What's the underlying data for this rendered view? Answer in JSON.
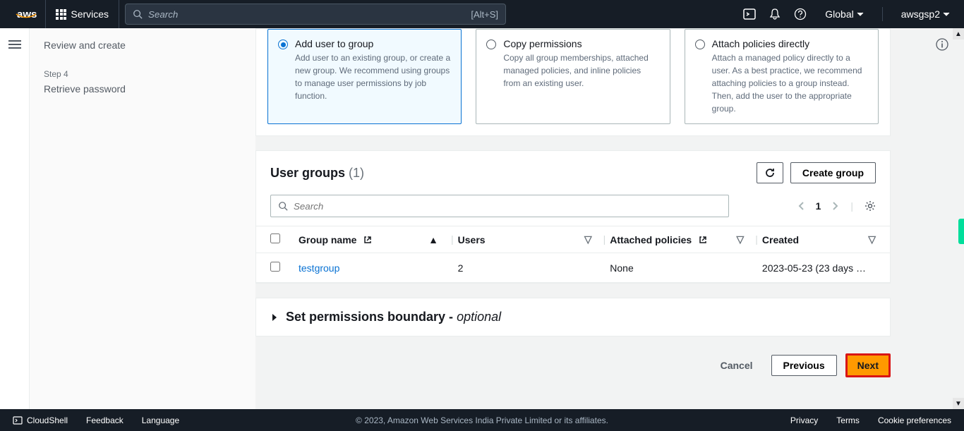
{
  "header": {
    "logo": "aws",
    "services": "Services",
    "search_placeholder": "Search",
    "shortcut": "[Alt+S]",
    "region": "Global",
    "account": "awsgsp2"
  },
  "sidebar": {
    "items": [
      {
        "label": "Review and create"
      },
      {
        "step": "Step 4",
        "label": "Retrieve password"
      }
    ]
  },
  "options": {
    "add_to_group": {
      "title": "Add user to group",
      "desc": "Add user to an existing group, or create a new group. We recommend using groups to manage user permissions by job function."
    },
    "copy": {
      "title": "Copy permissions",
      "desc": "Copy all group memberships, attached managed policies, and inline policies from an existing user."
    },
    "attach": {
      "title": "Attach policies directly",
      "desc": "Attach a managed policy directly to a user. As a best practice, we recommend attaching policies to a group instead. Then, add the user to the appropriate group."
    }
  },
  "groups": {
    "title": "User groups",
    "count": "(1)",
    "create_label": "Create group",
    "filter_placeholder": "Search",
    "page": "1",
    "columns": {
      "name": "Group name",
      "users": "Users",
      "policies": "Attached policies",
      "created": "Created"
    },
    "rows": [
      {
        "name": "testgroup",
        "users": "2",
        "policies": "None",
        "created": "2023-05-23 (23 days …"
      }
    ]
  },
  "boundary": {
    "title_prefix": "Set permissions boundary - ",
    "title_suffix": "optional"
  },
  "nav": {
    "cancel": "Cancel",
    "previous": "Previous",
    "next": "Next"
  },
  "footer": {
    "cloudshell": "CloudShell",
    "feedback": "Feedback",
    "language": "Language",
    "copyright": "© 2023, Amazon Web Services India Private Limited or its affiliates.",
    "privacy": "Privacy",
    "terms": "Terms",
    "cookie": "Cookie preferences"
  }
}
